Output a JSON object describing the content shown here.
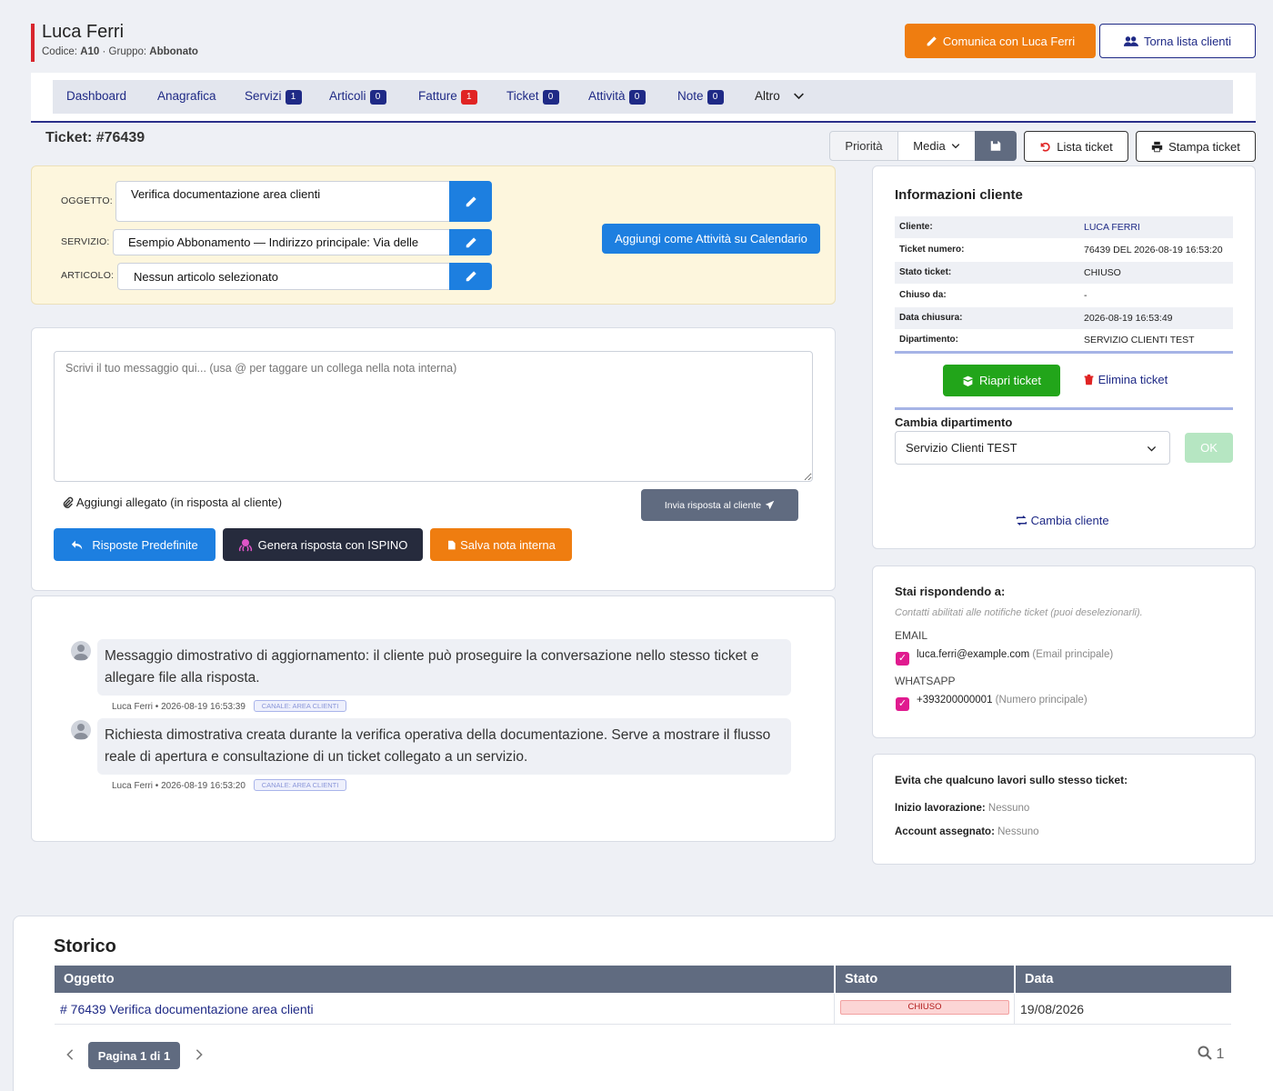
{
  "header": {
    "client_name": "Luca Ferri",
    "code_label": "Codice:",
    "code_value": "A10",
    "group_label": "· Gruppo:",
    "group_value": "Abbonato",
    "contact_button": "Comunica con Luca Ferri",
    "back_button": "Torna lista clienti"
  },
  "tabs": [
    {
      "label": "Dashboard"
    },
    {
      "label": "Anagrafica"
    },
    {
      "label": "Servizi",
      "count": "1"
    },
    {
      "label": "Articoli",
      "count": "0"
    },
    {
      "label": "Fatture",
      "count": "1"
    },
    {
      "label": "Ticket",
      "count": "0"
    },
    {
      "label": "Attività",
      "count": "0"
    },
    {
      "label": "Note",
      "count": "0"
    },
    {
      "label": "Altro"
    }
  ],
  "ticket": {
    "title": "Ticket: #76439",
    "priority_label": "Priorità",
    "priority_value": "Media",
    "list_button": "Lista ticket",
    "print_button": "Stampa ticket"
  },
  "form": {
    "subject_label": "OGGETTO:",
    "subject_value": "Verifica documentazione area clienti",
    "service_label": "SERVIZIO:",
    "service_value": "Esempio Abbonamento —  Indirizzo principale: Via delle",
    "article_label": "ARTICOLO:",
    "article_value": "Nessun articolo selezionato",
    "calendar_button": "Aggiungi come Attività su Calendario"
  },
  "reply": {
    "placeholder": "Scrivi il tuo messaggio qui... (usa @ per taggare un collega nella nota interna)",
    "attach_label": "Aggiungi allegato (in risposta al cliente)",
    "send_button": "Invia risposta al cliente",
    "predefined_button": "Risposte Predefinite",
    "ai_button": "Genera risposta con ISPINO",
    "internal_note_button": "Salva nota interna"
  },
  "messages": [
    {
      "text": "Messaggio dimostrativo di aggiornamento: il cliente può proseguire la conversazione nello stesso ticket e allegare file alla risposta.",
      "meta": "Luca Ferri • 2026-08-19 16:53:39",
      "channel": "CANALE: AREA CLIENTI"
    },
    {
      "text": "Richiesta dimostrativa creata durante la verifica operativa della documentazione. Serve a mostrare il flusso reale di apertura e consultazione di un ticket collegato a un servizio.",
      "meta": "Luca Ferri • 2026-08-19 16:53:20",
      "channel": "CANALE: AREA CLIENTI"
    }
  ],
  "client_info": {
    "title": "Informazioni cliente",
    "rows": [
      {
        "key": "Cliente:",
        "value": "LUCA FERRI"
      },
      {
        "key": "Ticket numero:",
        "value": "76439 DEL 2026-08-19 16:53:20"
      },
      {
        "key": "Stato ticket:",
        "value": "CHIUSO"
      },
      {
        "key": "Chiuso da:",
        "value": "-"
      },
      {
        "key": "Data chiusura:",
        "value": "2026-08-19 16:53:49"
      },
      {
        "key": "Dipartimento:",
        "value": "SERVIZIO CLIENTI TEST"
      }
    ],
    "reopen_button": "Riapri ticket",
    "delete_button": "Elimina ticket",
    "department_label": "Cambia dipartimento",
    "department_value": "Servizio Clienti TEST",
    "ok_button": "OK",
    "change_client": "Cambia cliente"
  },
  "replying_to": {
    "title": "Stai rispondendo a:",
    "hint": "Contatti abilitati alle notifiche ticket (puoi deselezionarli).",
    "email_label": "EMAIL",
    "email_value": "luca.ferri@example.com",
    "email_note": "(Email principale)",
    "whatsapp_label": "WHATSAPP",
    "whatsapp_value": "+393200000001",
    "whatsapp_note": "(Numero principale)"
  },
  "lock": {
    "title": "Evita che qualcuno lavori sullo stesso ticket:",
    "start_label": "Inizio lavorazione:",
    "start_value": "Nessuno",
    "account_label": "Account assegnato:",
    "account_value": "Nessuno"
  },
  "history": {
    "title": "Storico",
    "columns": [
      "Oggetto",
      "Stato",
      "Data"
    ],
    "rows": [
      {
        "subject": "# 76439 Verifica documentazione area clienti",
        "status": "CHIUSO",
        "date": "19/08/2026"
      }
    ],
    "page_label": "Pagina 1 di 1",
    "result_count": "1"
  },
  "colors": {
    "navy": "#1f2a86",
    "orange": "#ef7d10",
    "blue": "#1d7fe0",
    "green": "#22a51a",
    "red": "#e02424",
    "magenta": "#e01b8f"
  }
}
